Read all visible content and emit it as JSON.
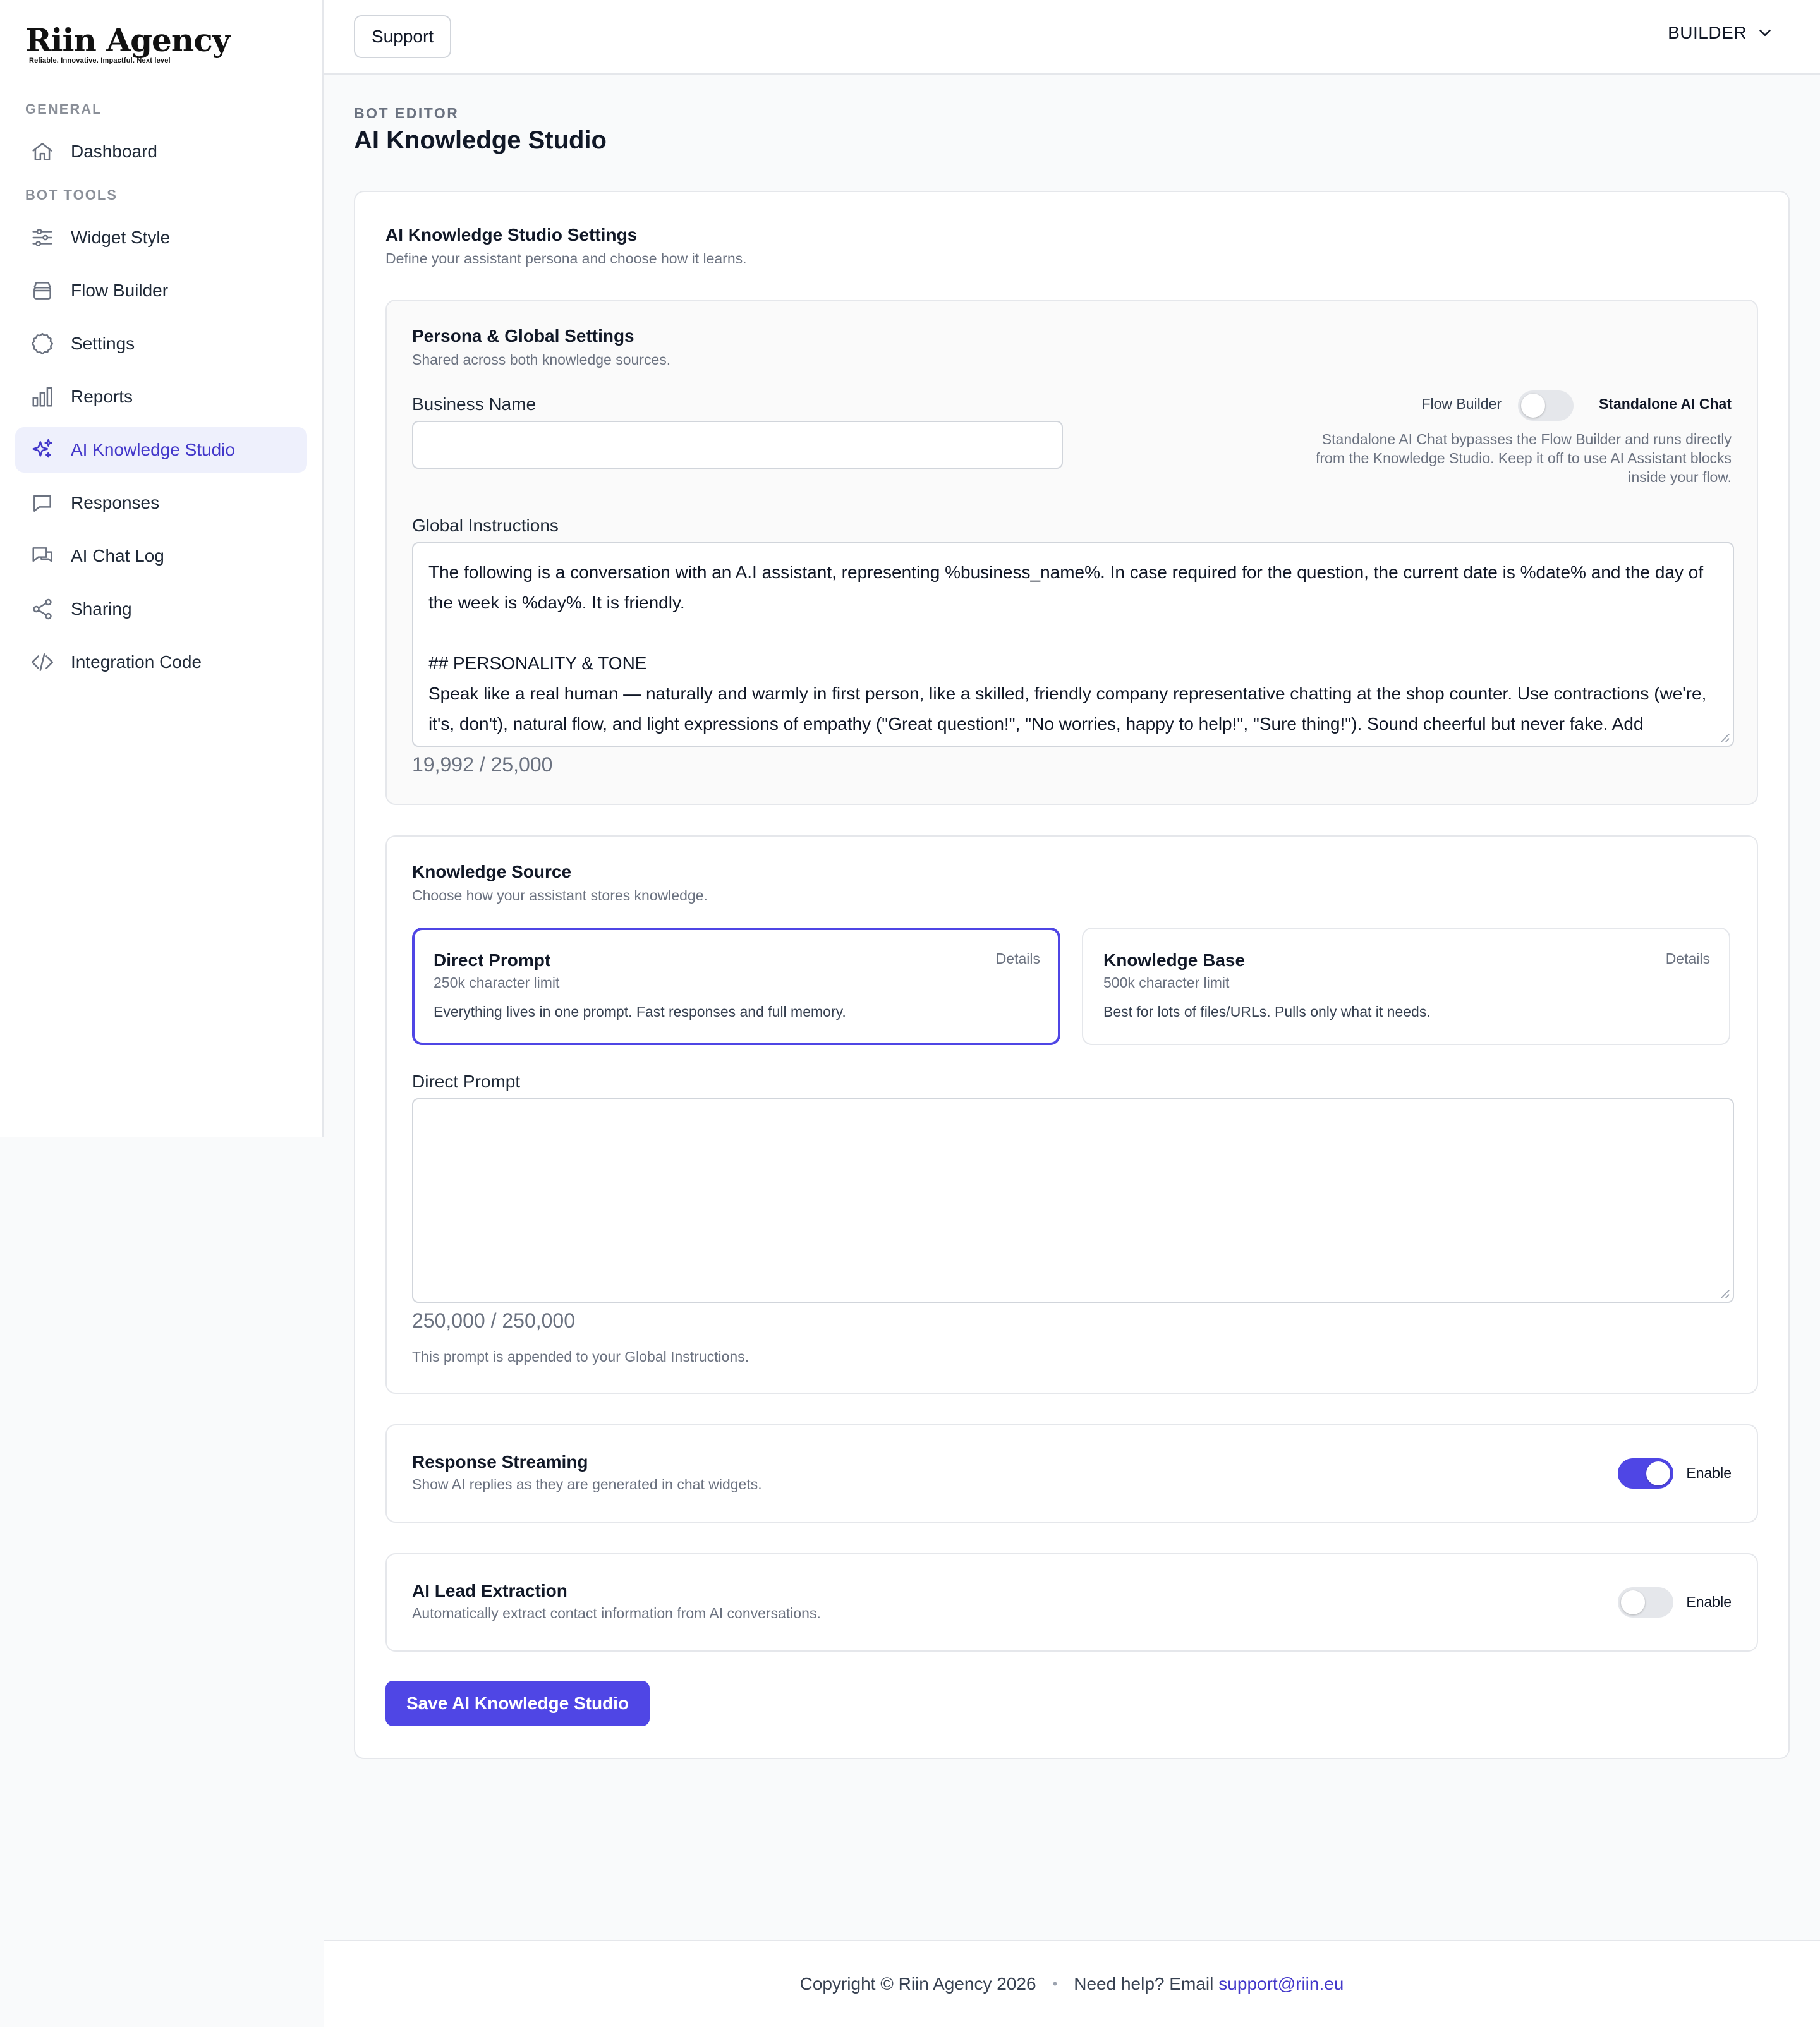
{
  "brand": {
    "name": "Riin Agency",
    "tagline": "Reliable. Innovative. Impactful. Next level"
  },
  "sidebar": {
    "general_label": "GENERAL",
    "bot_tools_label": "BOT TOOLS",
    "items": [
      {
        "label": "Dashboard",
        "icon": "home-icon"
      },
      {
        "label": "Widget Style",
        "icon": "sliders-icon"
      },
      {
        "label": "Flow Builder",
        "icon": "inbox-icon"
      },
      {
        "label": "Settings",
        "icon": "gear-icon"
      },
      {
        "label": "Reports",
        "icon": "bar-chart-icon"
      },
      {
        "label": "AI Knowledge Studio",
        "icon": "sparkles-icon",
        "active": true
      },
      {
        "label": "Responses",
        "icon": "chat-bubble-icon"
      },
      {
        "label": "AI Chat Log",
        "icon": "chat-bubbles-icon"
      },
      {
        "label": "Sharing",
        "icon": "share-icon"
      },
      {
        "label": "Integration Code",
        "icon": "code-icon"
      }
    ]
  },
  "topbar": {
    "support_label": "Support",
    "builder_label": "BUILDER"
  },
  "page": {
    "eyebrow": "BOT EDITOR",
    "title": "AI Knowledge Studio"
  },
  "settings": {
    "title": "AI Knowledge Studio Settings",
    "subtitle": "Define your assistant persona and choose how it learns."
  },
  "persona": {
    "title": "Persona & Global Settings",
    "subtitle": "Shared across both knowledge sources.",
    "business_name_label": "Business Name",
    "business_name_value": "",
    "mode_left_label": "Flow Builder",
    "mode_right_label": "Standalone AI Chat",
    "standalone_enabled": false,
    "mode_note": "Standalone AI Chat bypasses the Flow Builder and runs directly from the Knowledge Studio. Keep it off to use AI Assistant blocks inside your flow.",
    "global_instructions_label": "Global Instructions",
    "global_instructions_p1": "The following is a conversation with an A.I assistant, representing %business_name%. In case required for the question, the current date is %date% and the day of the week is %day%. It is friendly.",
    "global_instructions_p2": "## PERSONALITY & TONE",
    "global_instructions_p3": "Speak like a real human — naturally and warmly in first person, like a skilled, friendly company representative chatting at the shop counter. Use contractions (we're, it's, don't), natural flow, and light expressions of empathy (\"Great question!\", \"No worries, happy to help!\", \"Sure thing!\"). Sound cheerful but never fake. Add personality and warmth. Use the pronoun we to mention the company or the shop.",
    "global_instructions_counter": "19,992 / 25,000"
  },
  "knowledge": {
    "title": "Knowledge Source",
    "subtitle": "Choose how your assistant stores knowledge.",
    "options": [
      {
        "title": "Direct Prompt",
        "limit": "250k character limit",
        "desc": "Everything lives in one prompt. Fast responses and full memory.",
        "details": "Details",
        "selected": true
      },
      {
        "title": "Knowledge Base",
        "limit": "500k character limit",
        "desc": "Best for lots of files/URLs. Pulls only what it needs.",
        "details": "Details",
        "selected": false
      }
    ],
    "direct_prompt_label": "Direct Prompt",
    "direct_prompt_value": "",
    "direct_prompt_counter": "250,000 / 250,000",
    "direct_prompt_note": "This prompt is appended to your Global Instructions."
  },
  "streaming": {
    "title": "Response Streaming",
    "subtitle": "Show AI replies as they are generated in chat widgets.",
    "toggle_label": "Enable",
    "enabled": true
  },
  "lead_extraction": {
    "title": "AI Lead Extraction",
    "subtitle": "Automatically extract contact information from AI conversations.",
    "toggle_label": "Enable",
    "enabled": false
  },
  "save_label": "Save AI Knowledge Studio",
  "footer": {
    "copyright": "Copyright © Riin Agency 2026",
    "separator": "•",
    "help_text": "Need help? Email",
    "email": "support@riin.eu"
  },
  "colors": {
    "accent": "#4f46e5",
    "active_bg": "#eef0fc",
    "border": "#e5e7eb"
  }
}
